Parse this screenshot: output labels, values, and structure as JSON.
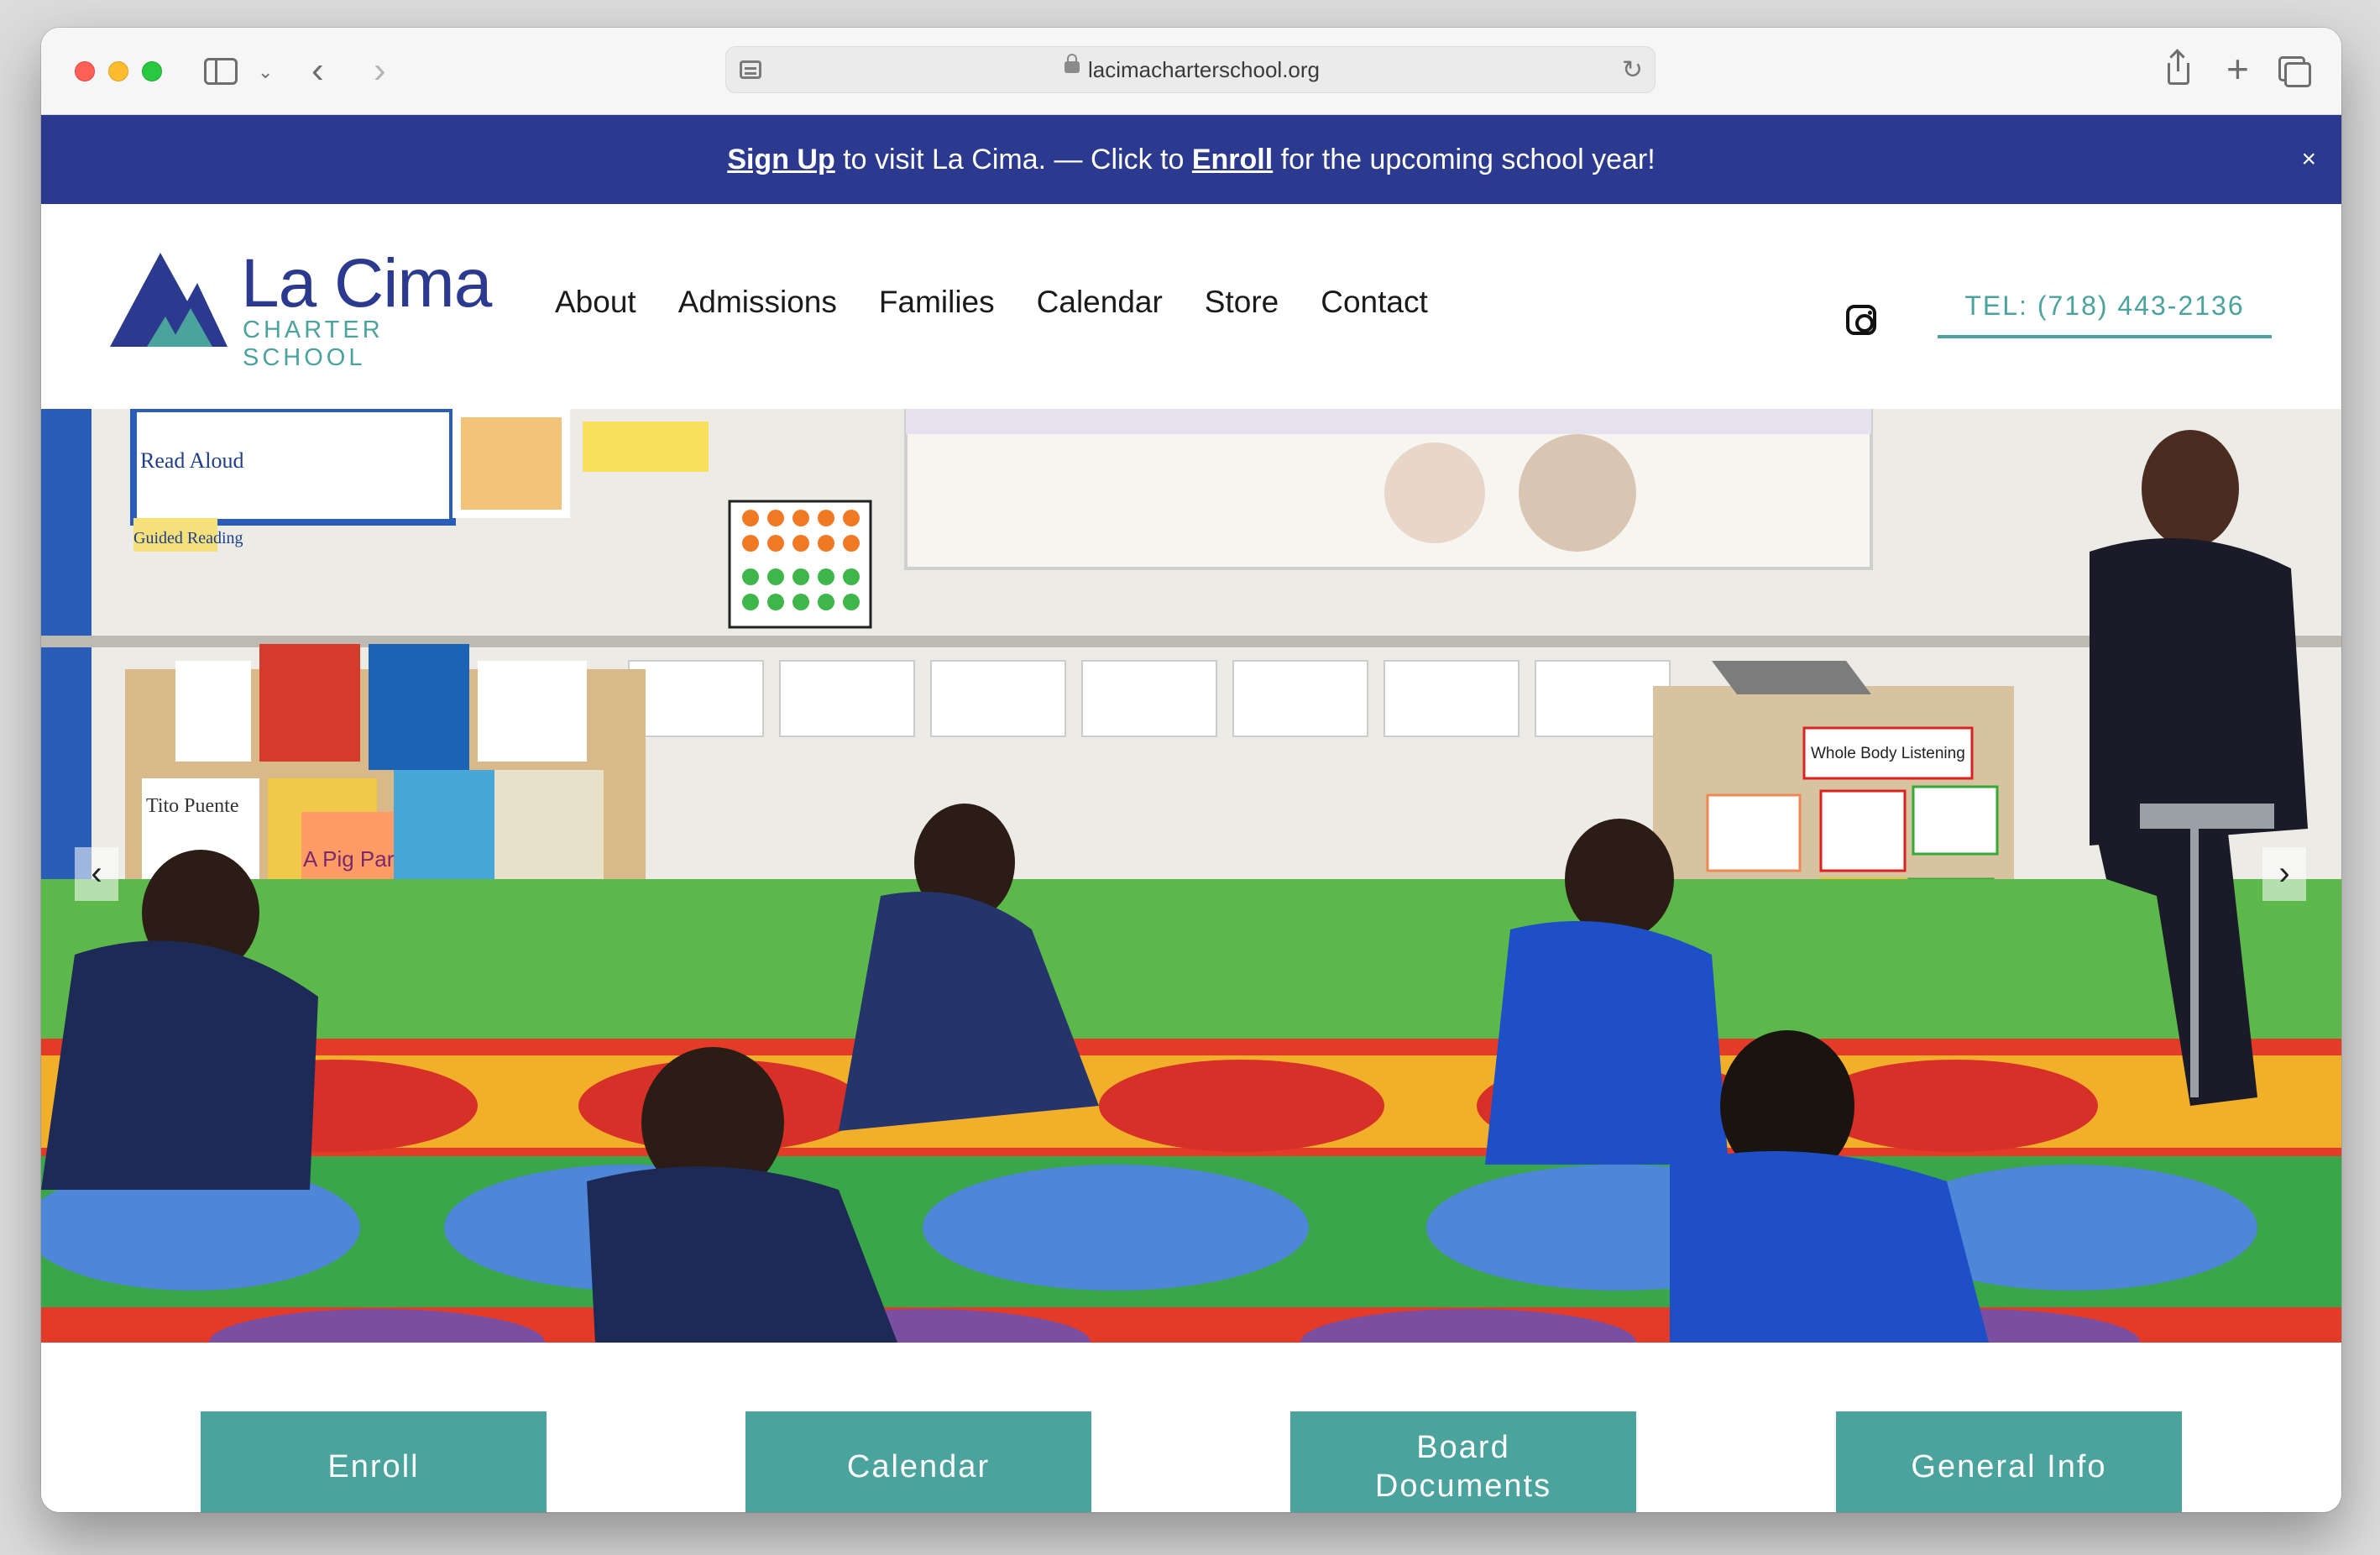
{
  "browser": {
    "url": "lacimacharterschool.org"
  },
  "announcement": {
    "signup_link": "Sign Up",
    "text_1": " to visit La Cima. — Click to ",
    "enroll_link": "Enroll",
    "text_2": " for the upcoming school year!",
    "close": "×"
  },
  "logo": {
    "title": "La Cima",
    "subtitle": "CHARTER SCHOOL"
  },
  "nav": {
    "items": [
      "About",
      "Admissions",
      "Families",
      "Calendar",
      "Store",
      "Contact"
    ]
  },
  "header": {
    "phone": "TEL: (718) 443-2136",
    "social_icon": "instagram-icon"
  },
  "hero": {
    "prev": "‹",
    "next": "›",
    "classroom_labels": {
      "read_aloud": "Read Aloud",
      "guided_reading": "Guided Reading",
      "whole_body": "Whole Body Listening",
      "book_1": "A Pig Parade",
      "book_2": "Tito Puente"
    }
  },
  "quick_links": {
    "enroll": "Enroll",
    "calendar": "Calendar",
    "board_documents": "Board Documents",
    "general_info": "General Info"
  },
  "colors": {
    "brand_navy": "#2b3a8f",
    "brand_teal": "#4aa39c"
  }
}
